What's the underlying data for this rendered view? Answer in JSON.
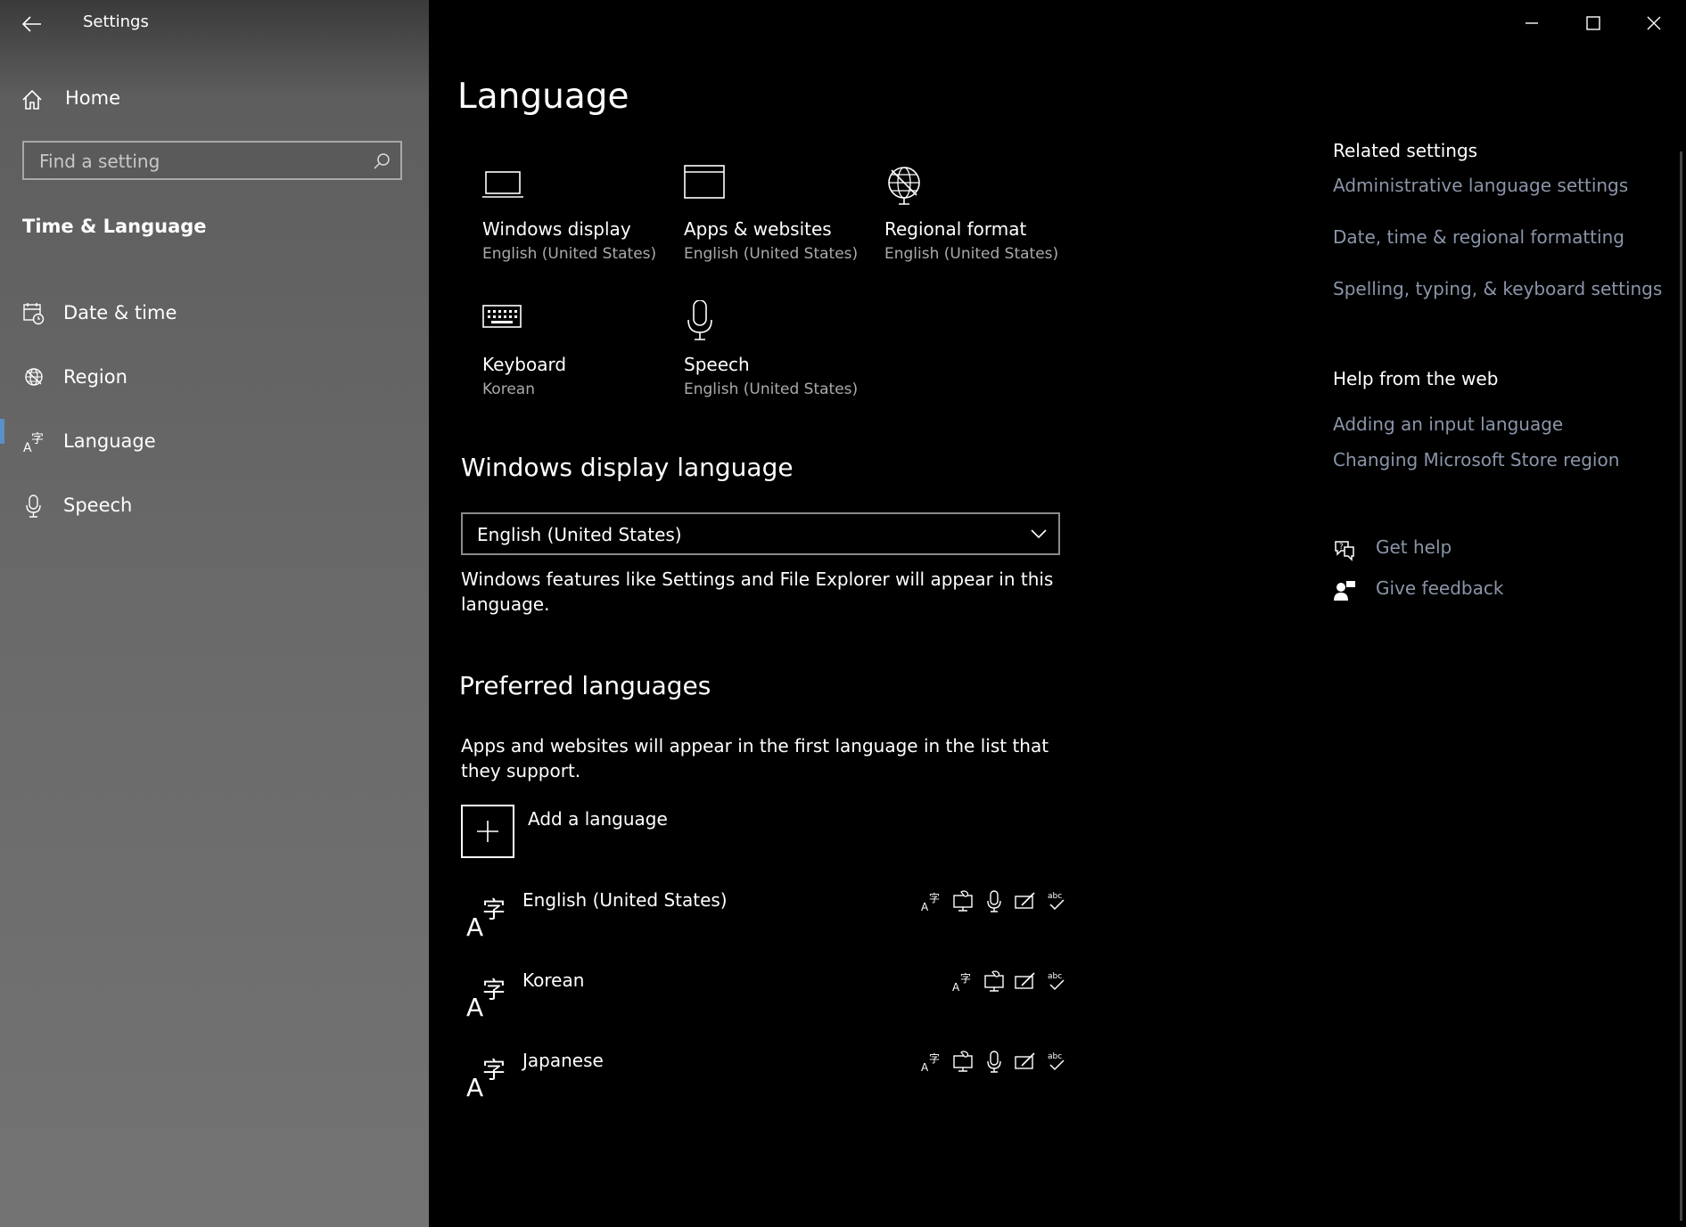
{
  "window": {
    "title": "Settings",
    "controls": {
      "minimize": "minimize-icon",
      "maximize": "maximize-icon",
      "close": "close-icon"
    }
  },
  "sidebar": {
    "home_label": "Home",
    "search_placeholder": "Find a setting",
    "section_title": "Time & Language",
    "items": [
      {
        "label": "Date & time",
        "icon": "calendar-clock-icon"
      },
      {
        "label": "Region",
        "icon": "globe-icon"
      },
      {
        "label": "Language",
        "icon": "language-icon",
        "selected": true
      },
      {
        "label": "Speech",
        "icon": "microphone-icon"
      }
    ]
  },
  "main": {
    "title": "Language",
    "tiles": [
      {
        "title": "Windows display",
        "subtitle": "English (United States)",
        "icon": "laptop-icon"
      },
      {
        "title": "Apps & websites",
        "subtitle": "English (United States)",
        "icon": "browser-window-icon"
      },
      {
        "title": "Regional format",
        "subtitle": "English (United States)",
        "icon": "globe-format-icon"
      },
      {
        "title": "Keyboard",
        "subtitle": "Korean",
        "icon": "keyboard-icon"
      },
      {
        "title": "Speech",
        "subtitle": "English (United States)",
        "icon": "microphone-icon"
      }
    ],
    "display_language": {
      "heading": "Windows display language",
      "selected": "English (United States)",
      "description": "Windows features like Settings and File Explorer will appear in this language."
    },
    "preferred": {
      "heading": "Preferred languages",
      "description": "Apps and websites will appear in the first language in the list that they support.",
      "add_label": "Add a language",
      "languages": [
        {
          "name": "English (United States)",
          "features": [
            "display-language-icon",
            "text-to-speech-icon",
            "speech-recognition-icon",
            "handwriting-icon",
            "spell-check-icon"
          ]
        },
        {
          "name": "Korean",
          "features": [
            "display-language-icon",
            "text-to-speech-icon",
            "handwriting-icon",
            "spell-check-icon"
          ]
        },
        {
          "name": "Japanese",
          "features": [
            "display-language-icon",
            "text-to-speech-icon",
            "speech-recognition-icon",
            "handwriting-icon",
            "spell-check-icon"
          ]
        }
      ]
    }
  },
  "related": {
    "heading": "Related settings",
    "links": [
      "Administrative language settings",
      "Date, time & regional formatting",
      "Spelling, typing, & keyboard settings"
    ]
  },
  "help": {
    "heading": "Help from the web",
    "links": [
      "Adding an input language",
      "Changing Microsoft Store region"
    ],
    "get_help": "Get help",
    "give_feedback": "Give feedback"
  },
  "colors": {
    "link": "#8a95a8",
    "accent_bar": "#5a8fc8",
    "background": "#000000"
  }
}
